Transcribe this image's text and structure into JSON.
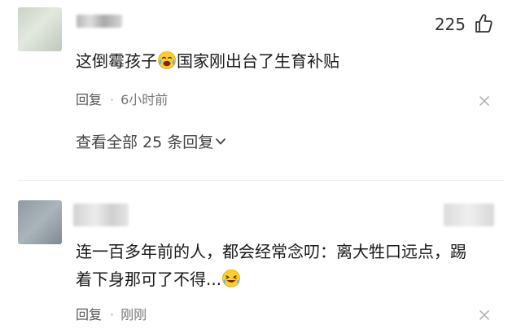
{
  "comments": [
    {
      "likes": "225",
      "text_before_emoji": "这倒霉孩子",
      "text_after_emoji": "国家刚出台了生育补贴",
      "reply_label": "回复",
      "separator": "·",
      "time": "6小时前",
      "view_replies": "查看全部 25 条回复"
    },
    {
      "text_line1": "连一百多年前的人，都会经常念叨：离大牲口远点，踢",
      "text_line2": "着下身那可了不得...",
      "reply_label": "回复",
      "separator": "·",
      "time": "刚刚"
    }
  ],
  "icons": {
    "like": "thumbs-up-icon",
    "close": "close-icon",
    "chevron": "chevron-down-icon",
    "emoji_cry": "crying-laugh-emoji-icon",
    "emoji_laugh": "laughing-tears-emoji-icon"
  },
  "colors": {
    "text": "#1a1a1a",
    "meta": "#666666",
    "divider": "#ececec"
  }
}
